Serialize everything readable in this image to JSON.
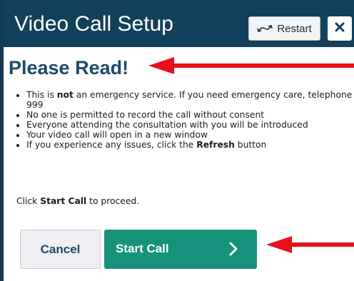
{
  "titlebar": {
    "title": "Video Call Setup",
    "restart_label": "Restart",
    "restart_icon": "restart-arrows-icon",
    "close_icon": "close-icon"
  },
  "content": {
    "heading": "Please Read!",
    "notices": [
      {
        "before": "This is ",
        "bold": "not",
        "after": " an emergency service. If you need emergency care, telephone",
        "cont": "999"
      },
      {
        "text": "No one is permitted to record the call without consent"
      },
      {
        "text": "Everyone attending the consultation with you will be introduced"
      },
      {
        "text": "Your video call will open in a new window"
      },
      {
        "before": "If you experience any issues, click the ",
        "bold": "Refresh",
        "after": " button"
      }
    ],
    "proceed": {
      "before": "Click ",
      "bold": "Start Call",
      "after": " to proceed."
    }
  },
  "actions": {
    "cancel_label": "Cancel",
    "start_label": "Start Call",
    "start_icon": "chevron-right-icon"
  },
  "annotations": {
    "arrow_icon": "red-arrow-icon",
    "arrow_color": "#e8101a"
  },
  "colors": {
    "titlebar": "#13405a",
    "heading": "#1d4b66",
    "start_button": "#16927c",
    "cancel_button": "#eef0f3"
  }
}
